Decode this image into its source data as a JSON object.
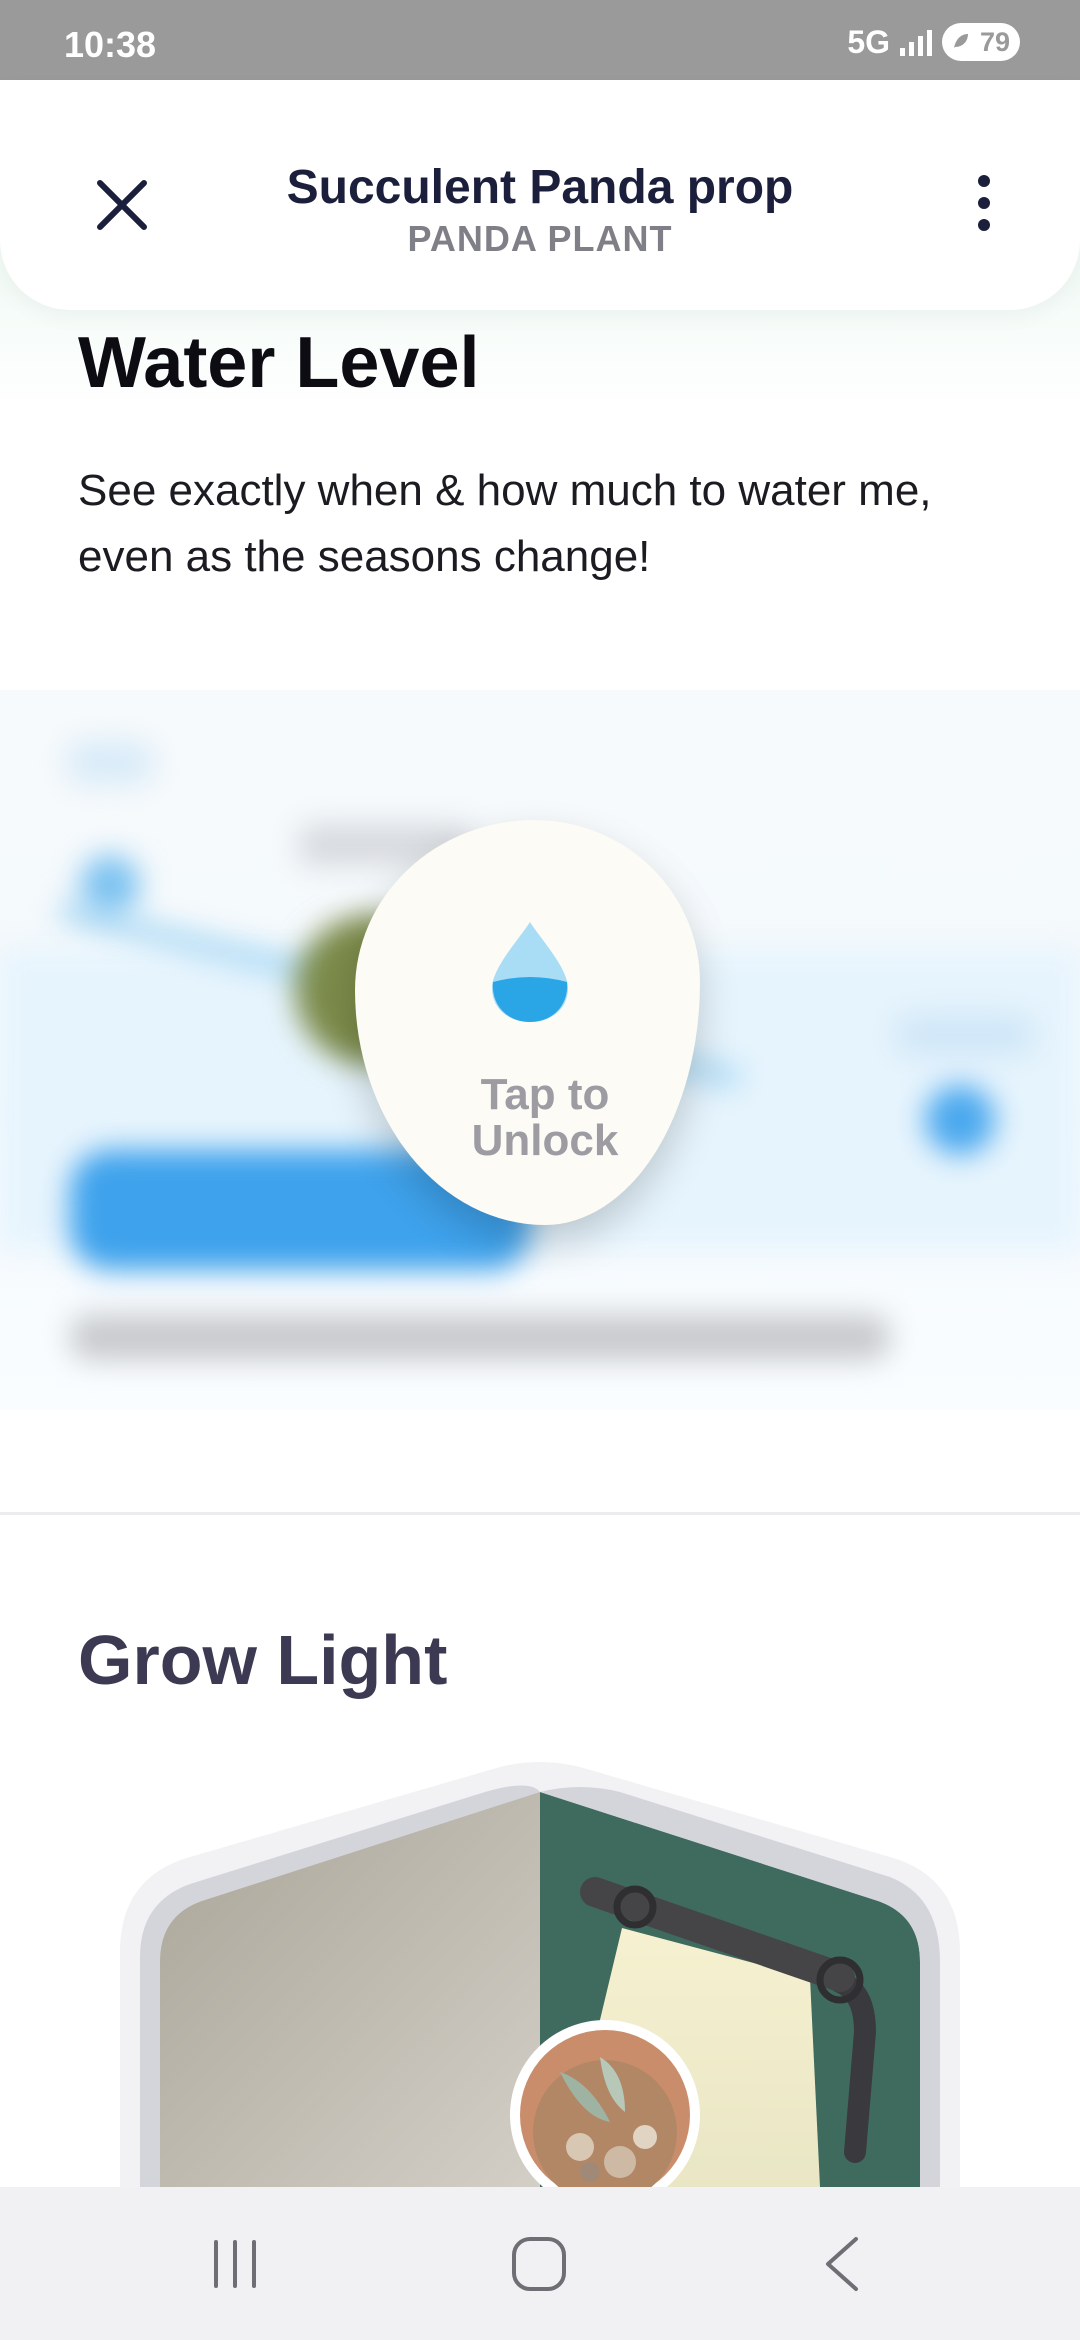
{
  "status_bar": {
    "time": "10:38",
    "network": "5G",
    "battery": "79"
  },
  "header": {
    "title": "Succulent Panda prop",
    "subtitle": "PANDA PLANT",
    "close_icon": "close-icon",
    "more_icon": "more-vertical-icon"
  },
  "water_level": {
    "title": "Water Level",
    "description": "See exactly when & how much to water me, even as the seasons change!",
    "unlock_label": "Tap to Unlock",
    "unlock_icon": "water-drop-icon"
  },
  "grow_light": {
    "title": "Grow Light"
  },
  "nav_bar": {
    "recents_icon": "recents-icon",
    "home_icon": "home-icon",
    "back_icon": "back-icon"
  },
  "colors": {
    "accent_blue": "#2aa5e6",
    "header_text": "#1b1f3b",
    "grow_teal": "#3f6b5f"
  }
}
